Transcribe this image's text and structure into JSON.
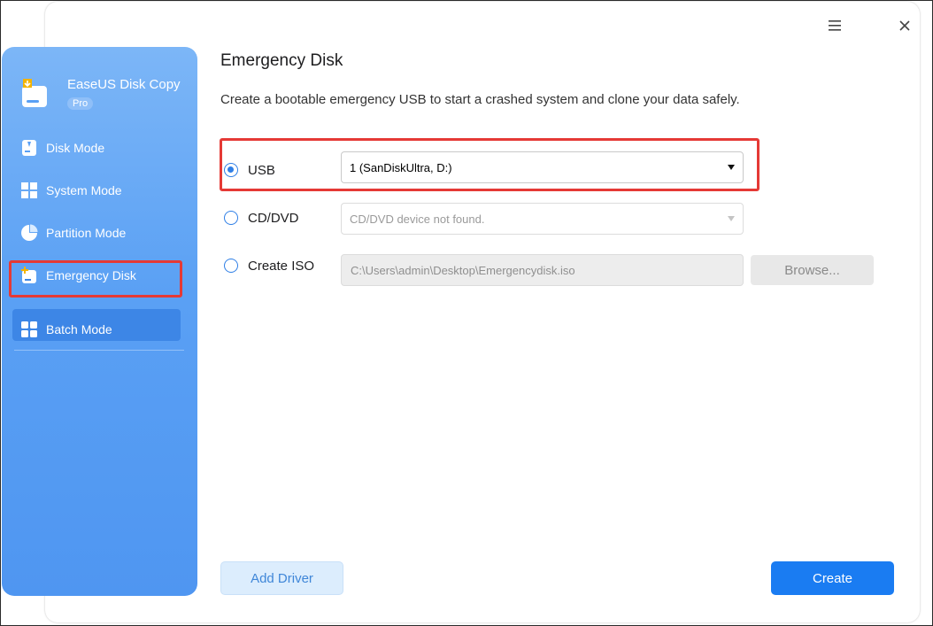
{
  "app": {
    "name": "EaseUS Disk Copy",
    "badge": "Pro"
  },
  "titlebar": {
    "menu_icon": "hamburger-menu-icon",
    "close_icon": "close-icon"
  },
  "sidebar": {
    "items": [
      {
        "label": "Disk Mode",
        "icon": "disk-icon"
      },
      {
        "label": "System Mode",
        "icon": "windows-icon"
      },
      {
        "label": "Partition Mode",
        "icon": "pie-chart-icon"
      },
      {
        "label": "Emergency Disk",
        "icon": "emergency-disk-icon",
        "active": true
      },
      {
        "label": "Batch Mode",
        "icon": "grid-icon"
      }
    ]
  },
  "main": {
    "title": "Emergency Disk",
    "description": "Create a bootable emergency USB to start a crashed system and clone your data safely.",
    "options": [
      {
        "label": "USB",
        "checked": true,
        "value": "1 (SanDiskUltra, D:)"
      },
      {
        "label": "CD/DVD",
        "checked": false,
        "value": "CD/DVD device not found."
      },
      {
        "label": "Create ISO",
        "checked": false,
        "value": "C:\\Users\\admin\\Desktop\\Emergencydisk.iso"
      }
    ],
    "browse_label": "Browse...",
    "add_driver_label": "Add Driver",
    "create_label": "Create"
  },
  "colors": {
    "accent": "#1a7cf2",
    "sidebar_top": "#7cb6f7",
    "sidebar_bottom": "#4f96f1",
    "highlight_box": "#e53935"
  }
}
